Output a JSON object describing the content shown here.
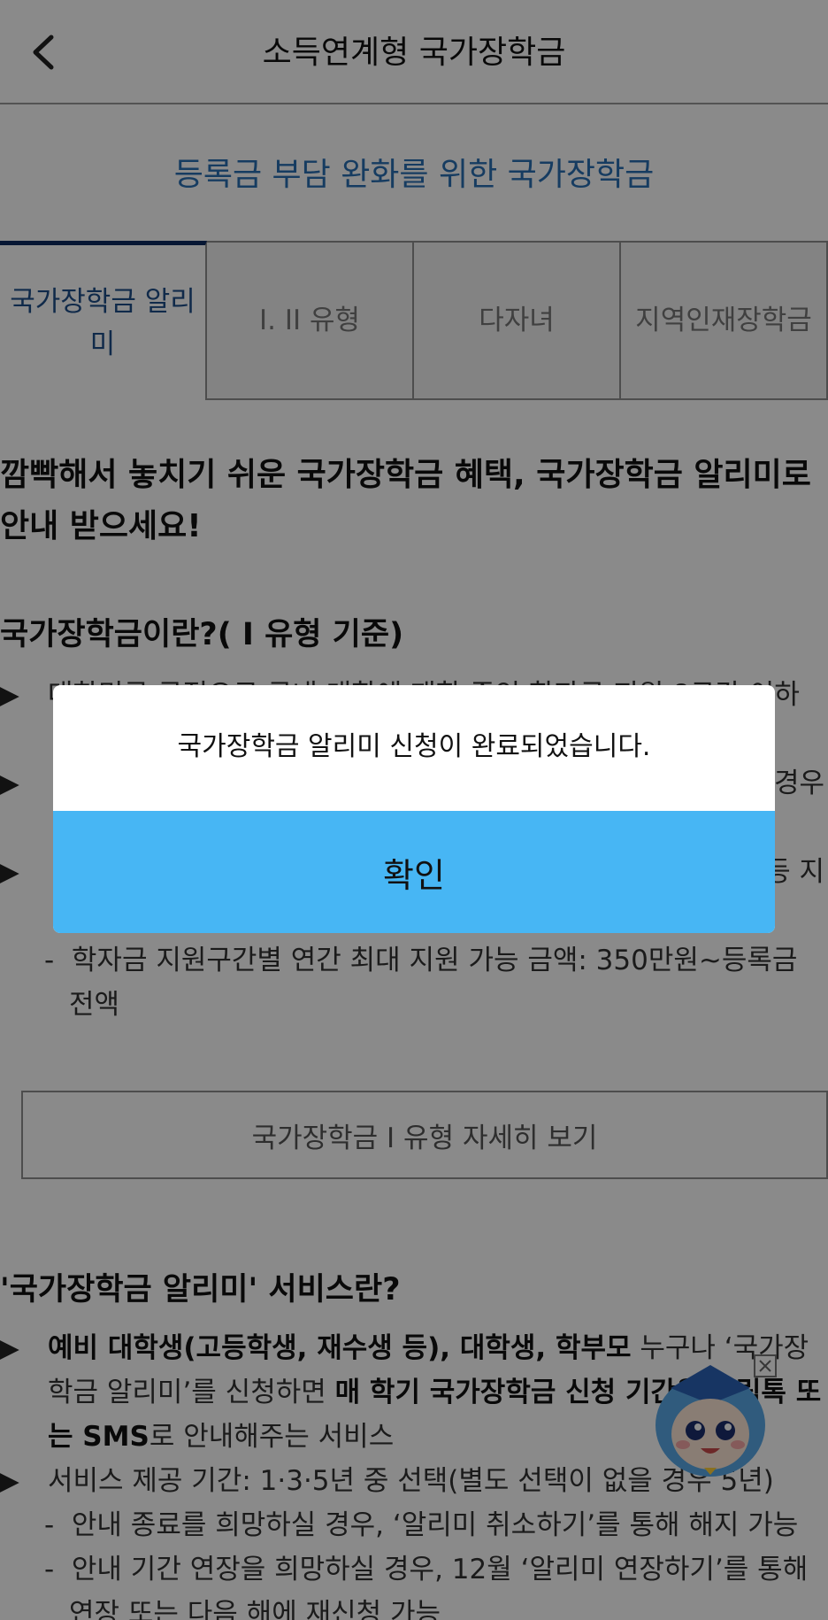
{
  "header": {
    "title": "소득연계형 국가장학금"
  },
  "banner": {
    "text": "등록금 부담 완화를 위한 국가장학금"
  },
  "tabs": [
    {
      "label": "국가장학금 알리미",
      "active": true
    },
    {
      "label": "I. II 유형",
      "active": false
    },
    {
      "label": "다자녀",
      "active": false
    },
    {
      "label": "지역인재장학금",
      "active": false
    }
  ],
  "content": {
    "intro": "깜빡해서 놓치기 쉬운 국가장학금 혜택, 국가장학금 알리미로 안내 받으세요!",
    "section1_title": "국가장학금이란?( I 유형 기준)",
    "section1_bullets": [
      "대한민국 국적으로 국내 대학에 재학 중인 학자금 지원 8구간 이하",
      "경우",
      "등 지"
    ],
    "section1_dash": "학자금 지원구간별 연간 최대 지원 가능 금액: 350만원~등록금 전액",
    "detail_button": "국가장학금 I 유형 자세히 보기",
    "section2_title": "'국가장학금 알리미' 서비스란?",
    "section2_bullet1_parts": [
      "예비 대학생(고등학생, 재수생 등), 대학생, 학부모",
      " 누구나 ‘국가장학금 알리미’를 신청하면 ",
      "매 학기 국가장학금 신청 기간을 알림톡 또는 SMS",
      "로 안내해주는 서비스"
    ],
    "section2_bullet2": "서비스 제공 기간: 1·3·5년 중 선택(별도 선택이 없을 경우 5년)",
    "section2_dash1": "안내 종료를 희망하실 경우, ‘알리미 취소하기’를 통해 해지 가능",
    "section2_dash2": "안내 기간 연장을 희망하실 경우, 12월 ‘알리미 연장하기’를 통해 연장 또는 다음 해에 재신청 가능"
  },
  "modal": {
    "message": "국가장학금 알리미 신청이 완료되었습니다.",
    "confirm_label": "확인"
  },
  "colors": {
    "banner_text": "#2a6fb3",
    "active_tab_border": "#0c2a5e",
    "confirm_button": "#47b6f4",
    "overlay": "rgba(0,0,0,0.46)"
  },
  "icons": {
    "back": "chevron-left-icon",
    "mascot": "mascot-character-icon",
    "mascot_close": "close-box-icon"
  }
}
